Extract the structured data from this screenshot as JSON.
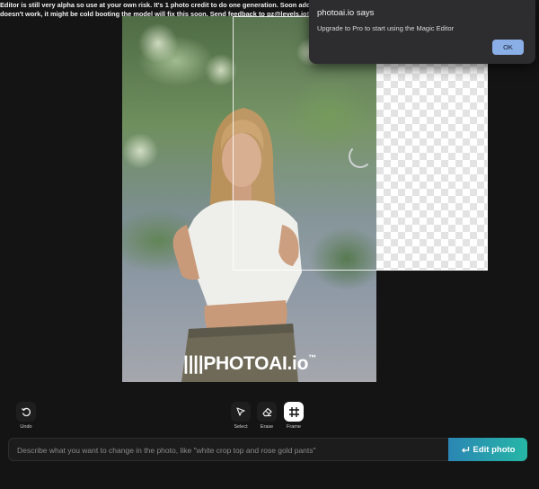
{
  "banner": {
    "line1": "Editor is still very alpha so use at your own risk. It's 1 photo credit to do one generation. Soon adding [ Save ] but",
    "line2": "doesn't work, it might be cold booting the model will fix this soon. Send feedback to pz@levels.io!"
  },
  "image": {
    "watermark_brand": "PHOTO",
    "watermark_suffix": "AI.io",
    "watermark_tm": "™"
  },
  "dialog": {
    "title": "photoai.io says",
    "message": "Upgrade to Pro to start using the Magic Editor",
    "ok_label": "OK"
  },
  "toolbar": {
    "undo_label": "Undo",
    "select_label": "Select",
    "erase_label": "Erase",
    "frame_label": "Frame",
    "active_tool": "Frame"
  },
  "prompt": {
    "placeholder": "Describe what you want to change in the photo, like \"white crop top and rose gold pants\"",
    "value": ""
  },
  "edit_button": {
    "label": "Edit photo",
    "icon": "return-arrow-icon"
  },
  "colors": {
    "background": "#141414",
    "accent_start": "#2b86b4",
    "accent_end": "#25b7a6",
    "dialog_ok": "#8aaee6"
  }
}
